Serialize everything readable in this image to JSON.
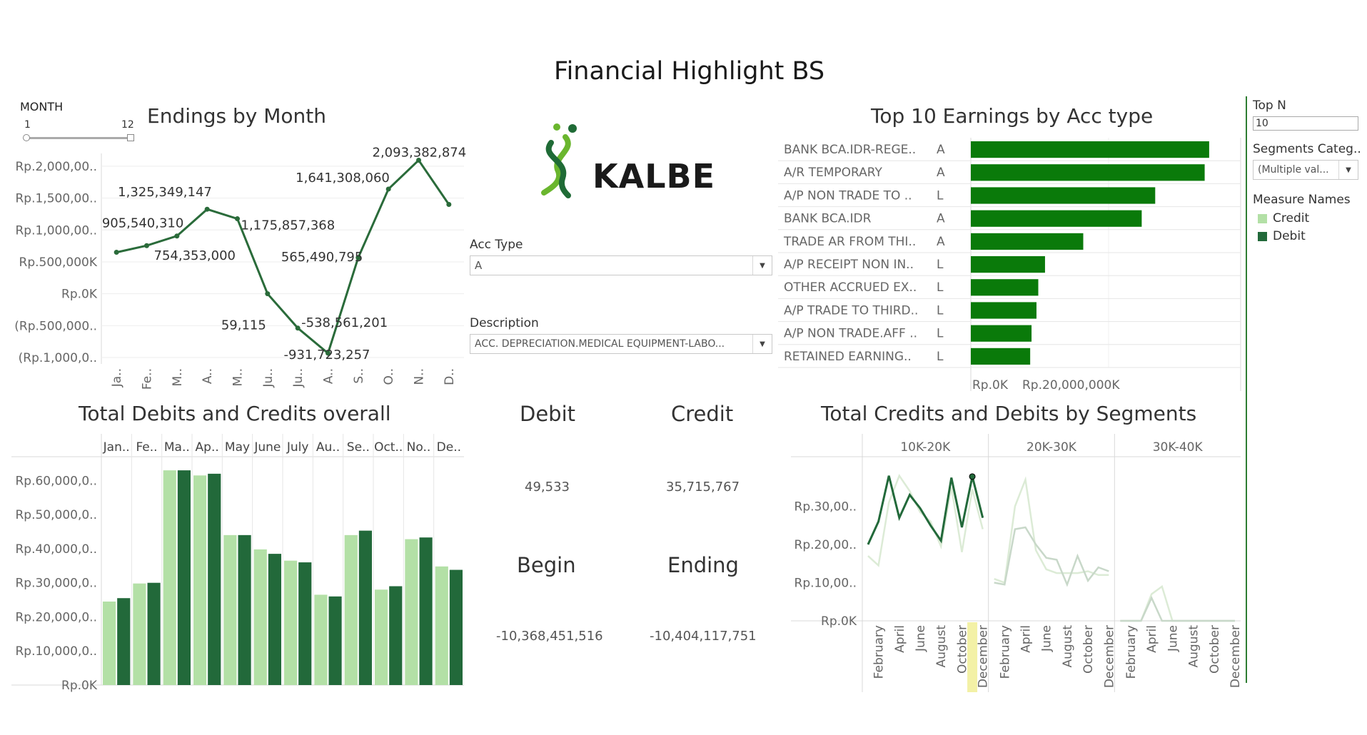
{
  "page_title": "Financial Highlight BS",
  "month_filter": {
    "label": "MONTH",
    "min": "1",
    "max": "12"
  },
  "logo_text": "KALBE",
  "acc_type": {
    "label": "Acc Type",
    "value": "A"
  },
  "description": {
    "label": "Description",
    "value": "ACC. DEPRECIATION.MEDICAL EQUIPMENT-LABO..."
  },
  "top_n": {
    "label": "Top N",
    "value": "10"
  },
  "segments": {
    "label": "Segments Categ..",
    "value": "(Multiple val..."
  },
  "legend": {
    "title": "Measure Names",
    "items": [
      {
        "label": "Credit",
        "color": "#b3e0a6"
      },
      {
        "label": "Debit",
        "color": "#22693a"
      }
    ]
  },
  "kpis": {
    "debit_label": "Debit",
    "debit_value": "49,533",
    "credit_label": "Credit",
    "credit_value": "35,715,767",
    "begin_label": "Begin",
    "begin_value": "-10,368,451,516",
    "ending_label": "Ending",
    "ending_value": "-10,404,117,751"
  },
  "chart_data": [
    {
      "type": "line",
      "title": "Endings by Month",
      "x": [
        "Ja..",
        "Fe..",
        "M..",
        "A..",
        "M..",
        "Ju..",
        "Ju..",
        "A..",
        "S..",
        "O..",
        "N..",
        "D.."
      ],
      "y_tick_labels": [
        "Rp.2,000,00..",
        "Rp.1,500,00..",
        "Rp.1,000,00..",
        "Rp.500,000K",
        "Rp.0K",
        "(Rp.500,000..",
        "(Rp.1,000,0.."
      ],
      "y_ticks": [
        2000000000,
        1500000000,
        1000000000,
        500000000,
        0,
        -500000000,
        -1000000000
      ],
      "ylim": [
        -1100000000,
        2200000000
      ],
      "values": [
        650000000,
        754353000,
        905540310,
        1325349147,
        1175857368,
        59115,
        -538561201,
        -931723257,
        565490795,
        1641308060,
        2093382874,
        1400000000
      ],
      "data_labels": [
        null,
        "754,353,000",
        "905,540,310",
        "1,325,349,147",
        "1,175,857,368",
        "59,115",
        "-538,561,201",
        "-931,723,257",
        "565,490,795",
        "1,641,308,060",
        "2,093,382,874",
        null
      ],
      "color": "#2a6b3a"
    },
    {
      "type": "bar",
      "title": "Top 10 Earnings by Acc type",
      "categories": [
        "BANK BCA.IDR-REGE..",
        "A/R TEMPORARY",
        "A/P NON TRADE TO ..",
        "BANK BCA.IDR",
        "TRADE AR FROM THI..",
        "A/P RECEIPT NON IN..",
        "OTHER ACCRUED EX..",
        "A/P TRADE TO THIRD..",
        "A/P NON TRADE.AFF ..",
        "RETAINED EARNING.."
      ],
      "acc_types": [
        "A",
        "A",
        "L",
        "A",
        "A",
        "L",
        "L",
        "L",
        "L",
        "L"
      ],
      "values": [
        53000000000,
        52000000000,
        41000000000,
        38000000000,
        25000000000,
        16500000000,
        15000000000,
        14600000000,
        13500000000,
        13200000000
      ],
      "x_tick_labels": [
        "Rp.0K",
        "Rp.20,000,000K"
      ],
      "xlim": [
        0,
        60000000000
      ],
      "color": "#0a7a0a"
    },
    {
      "type": "bar",
      "title": "Total Debits and Credits overall",
      "categories": [
        "Jan..",
        "Fe..",
        "Ma..",
        "Ap..",
        "May",
        "June",
        "July",
        "Au..",
        "Se..",
        "Oct..",
        "No..",
        "De.."
      ],
      "series": [
        {
          "name": "Credit",
          "values": [
            24500000000,
            29800000000,
            63000000000,
            61500000000,
            44000000000,
            39800000000,
            36500000000,
            26500000000,
            44000000000,
            28000000000,
            42800000000,
            34800000000
          ]
        },
        {
          "name": "Debit",
          "values": [
            25500000000,
            30000000000,
            63000000000,
            62000000000,
            44000000000,
            38500000000,
            36000000000,
            26000000000,
            45300000000,
            29000000000,
            43300000000,
            33800000000
          ]
        }
      ],
      "y_tick_labels": [
        "Rp.60,000,0..",
        "Rp.50,000,0..",
        "Rp.40,000,0..",
        "Rp.30,000,0..",
        "Rp.20,000,0..",
        "Rp.10,000,0..",
        "Rp.0K"
      ],
      "y_ticks": [
        60000000000,
        50000000000,
        40000000000,
        30000000000,
        20000000000,
        10000000000,
        0
      ],
      "ylim": [
        0,
        67000000000
      ]
    },
    {
      "type": "line",
      "title": "Total Credits and Debits by Segments",
      "panels": [
        "10K-20K",
        "20K-30K",
        "30K-40K"
      ],
      "x": [
        "January",
        "February",
        "March",
        "April",
        "May",
        "June",
        "July",
        "August",
        "September",
        "October",
        "November",
        "December"
      ],
      "x_tick_labels": [
        "February",
        "April",
        "June",
        "August",
        "October",
        "December"
      ],
      "y_tick_labels": [
        "Rp.30,00..",
        "Rp.20,00..",
        "Rp.10,00..",
        "Rp.0K"
      ],
      "y_ticks": [
        30000000000,
        20000000000,
        10000000000,
        0
      ],
      "ylim": [
        0,
        43000000000
      ],
      "series": [
        {
          "name": "Credit",
          "panel": "10K-20K",
          "values": [
            17000000000,
            14500000000,
            31000000000,
            38000000000,
            34000000000,
            28500000000,
            26000000000,
            19500000000,
            35000000000,
            18000000000,
            34500000000,
            24000000000
          ]
        },
        {
          "name": "Debit",
          "panel": "10K-20K",
          "values": [
            20000000000,
            26000000000,
            38000000000,
            27000000000,
            33000000000,
            29500000000,
            25000000000,
            21000000000,
            37500000000,
            24500000000,
            37800000000,
            27000000000
          ]
        },
        {
          "name": "Credit",
          "panel": "20K-30K",
          "values": [
            11000000000,
            10000000000,
            30000000000,
            37000000000,
            18500000000,
            13500000000,
            12500000000,
            12500000000,
            12500000000,
            13000000000,
            12000000000,
            12000000000
          ]
        },
        {
          "name": "Debit",
          "panel": "20K-30K",
          "values": [
            10000000000,
            9500000000,
            24000000000,
            24500000000,
            20000000000,
            16500000000,
            16000000000,
            9500000000,
            17000000000,
            10500000000,
            14000000000,
            13000000000
          ]
        },
        {
          "name": "Credit",
          "panel": "30K-40K",
          "values": [
            0,
            0,
            0,
            7000000000,
            9000000000,
            0,
            0,
            0,
            0,
            0,
            0,
            0
          ]
        },
        {
          "name": "Debit",
          "panel": "30K-40K",
          "values": [
            0,
            0,
            0,
            6000000000,
            0,
            0,
            0,
            0,
            0,
            0,
            0,
            0
          ]
        }
      ]
    }
  ]
}
